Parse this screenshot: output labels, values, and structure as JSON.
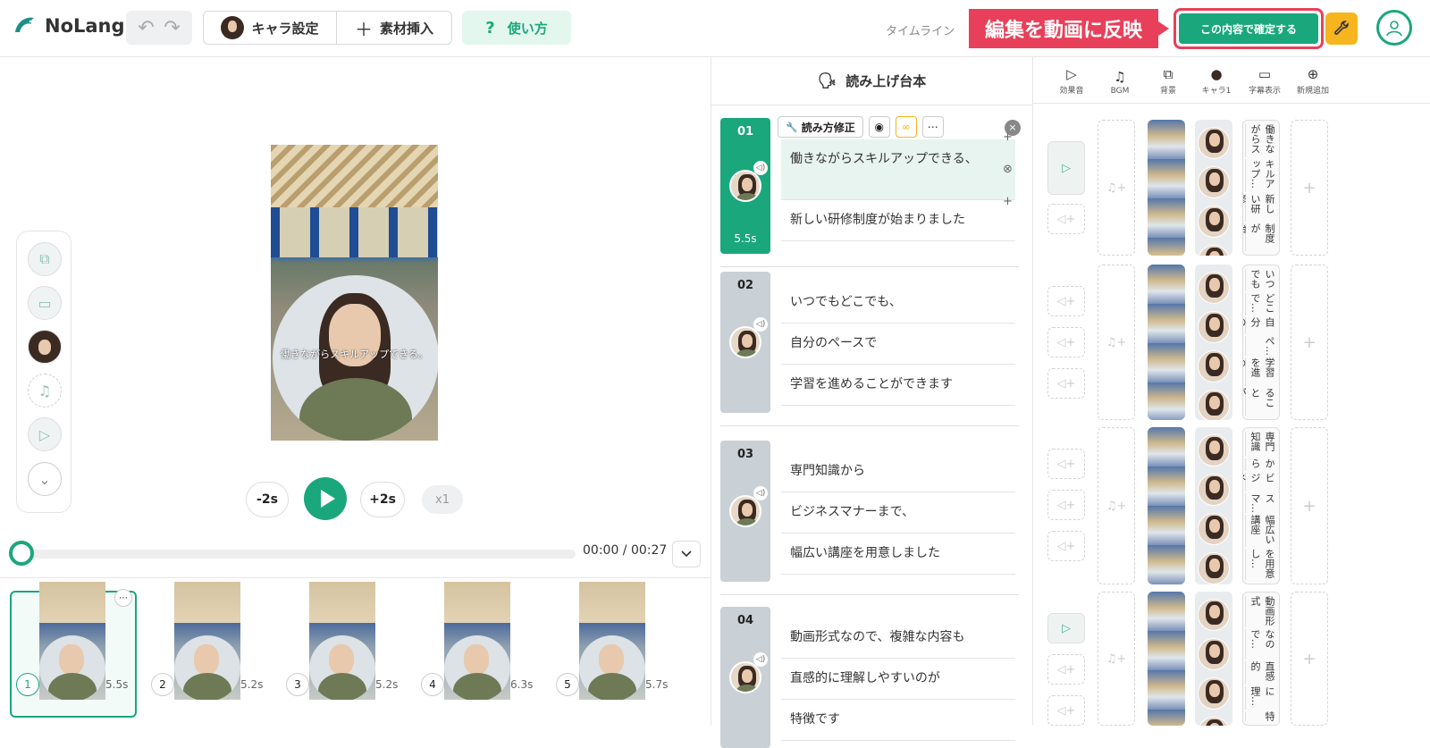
{
  "header": {
    "app_name": "NoLang",
    "chara_label": "キャラ設定",
    "insert_label": "素材挿入",
    "help_label": "使い方",
    "timeline_label": "タイムライン",
    "callout_text": "編集を動画に反映",
    "confirm_label": "この内容で確定する"
  },
  "preview": {
    "subtitle": "働きながらスキルアップできる。",
    "back_label": "-2s",
    "forward_label": "+2s",
    "speed_label": "x1",
    "time_current": "00:00",
    "time_total": "00:27",
    "time_text": "00:00 / 00:27"
  },
  "thumbnails": [
    {
      "num": "1",
      "duration": "5.5s",
      "active": true
    },
    {
      "num": "2",
      "duration": "5.2s",
      "active": false
    },
    {
      "num": "3",
      "duration": "5.2s",
      "active": false
    },
    {
      "num": "4",
      "duration": "6.3s",
      "active": false
    },
    {
      "num": "5",
      "duration": "5.7s",
      "active": false
    }
  ],
  "script_panel": {
    "title": "読み上げ台本",
    "fix_reading_label": "読み方修正",
    "scenes": [
      {
        "num": "01",
        "duration": "5.5s",
        "lines": [
          "働きながらスキルアップできる、",
          "新しい研修制度が始まりました"
        ]
      },
      {
        "num": "02",
        "duration": "",
        "lines": [
          "いつでもどこでも、",
          "自分のペースで",
          "学習を進めることができます"
        ]
      },
      {
        "num": "03",
        "duration": "",
        "lines": [
          "専門知識から",
          "ビジネスマナーまで、",
          "幅広い講座を用意しました"
        ]
      },
      {
        "num": "04",
        "duration": "",
        "lines": [
          "動画形式なので、複雑な内容も",
          "直感的に理解しやすいのが",
          "特徴です"
        ]
      }
    ]
  },
  "timeline_tabs": [
    "効果音",
    "BGM",
    "背景",
    "キャラ1",
    "字幕表示",
    "新規追加"
  ],
  "subtitle_chunks": [
    [
      "働きながらス",
      "キルアップ…",
      "新しい研修",
      "制度が始…"
    ],
    [
      "いつでも",
      "どこで…",
      "自分の",
      "ペ…",
      "学習を進め",
      "ることが…"
    ],
    [
      "専門知識",
      "から",
      "ビジネ",
      "スマ…",
      "幅広い講座",
      "を用意し…"
    ],
    [
      "動画形式",
      "なので…",
      "直感的",
      "に理…",
      "特"
    ]
  ],
  "colors": {
    "accent": "#1aa77b",
    "highlight": "#e8405a",
    "wrench": "#f6b51e"
  }
}
